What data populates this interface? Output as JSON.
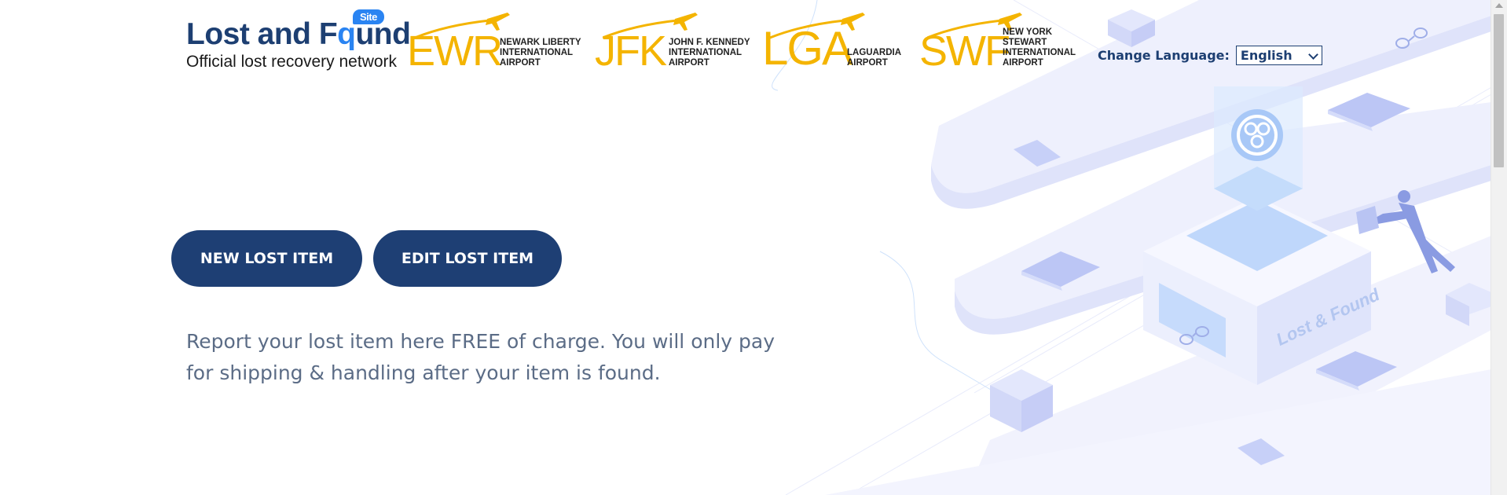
{
  "brand": {
    "title_start": "Lost and F",
    "title_q": "q",
    "title_end": "und",
    "badge": "Site",
    "subtitle": "Official lost recovery network"
  },
  "airports": [
    {
      "code": "EWR",
      "name": "NEWARK LIBERTY\nINTERNATIONAL\nAIRPORT"
    },
    {
      "code": "JFK",
      "name": "JOHN F. KENNEDY\nINTERNATIONAL\nAIRPORT"
    },
    {
      "code": "LGA",
      "name": "LAGUARDIA\nAIRPORT"
    },
    {
      "code": "SWF",
      "name": "NEW YORK STEWART\nINTERNATIONAL\nAIRPORT"
    }
  ],
  "language": {
    "label": "Change Language:",
    "selected": "English"
  },
  "actions": {
    "new_label": "NEW LOST ITEM",
    "edit_label": "EDIT LOST ITEM"
  },
  "description": "Report your lost item here FREE of charge. You will only pay for shipping & handling after your item is found.",
  "illustration": {
    "kiosk_label": "Lost & Found"
  },
  "colors": {
    "brand_navy": "#1e3f74",
    "accent_blue": "#2a84f2",
    "airport_yellow": "#f4b400",
    "text_gray": "#5b6c86"
  }
}
